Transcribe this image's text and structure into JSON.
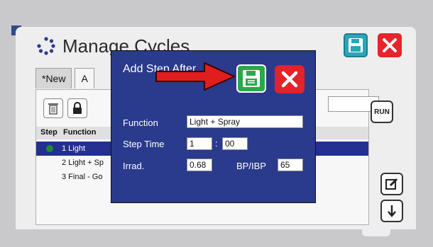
{
  "window": {
    "title": "Manage Cycles"
  },
  "tabs": [
    {
      "label": "*New"
    },
    {
      "label": "A"
    }
  ],
  "step_list": {
    "headers": {
      "step": "Step",
      "function": "Function"
    },
    "rows": [
      {
        "label": "1 Light"
      },
      {
        "label": "2 Light + Sp"
      },
      {
        "label": "3 Final - Go"
      }
    ]
  },
  "side_buttons": {
    "run_label": "RUN"
  },
  "dialog": {
    "title": "Add Step After",
    "fields": {
      "function_label": "Function",
      "function_value": "Light + Spray",
      "step_time_label": "Step Time",
      "step_time_minutes": "1",
      "step_time_seconds": "00",
      "colon": ":",
      "irrad_label": "Irrad.",
      "irrad_value": "0.68",
      "bp_label": "BP/IBP",
      "bp_value": "65"
    }
  },
  "colors": {
    "dialog_bg": "#2a3a8c",
    "selected_row": "#23308f",
    "save_green": "#2ea64a",
    "close_red": "#e3222a",
    "teal_save": "#2aa6b8",
    "arrow_red": "#e01e1e"
  },
  "icons": {
    "window_title": "cycle-icon",
    "main_save": "floppy-disk-icon",
    "main_close": "close-x-icon",
    "trash": "trash-icon",
    "lock": "lock-icon",
    "edit": "edit-icon",
    "down": "down-arrow-icon",
    "dialog_save": "floppy-disk-icon",
    "dialog_close": "close-x-icon",
    "pointer": "red-arrow-icon"
  }
}
